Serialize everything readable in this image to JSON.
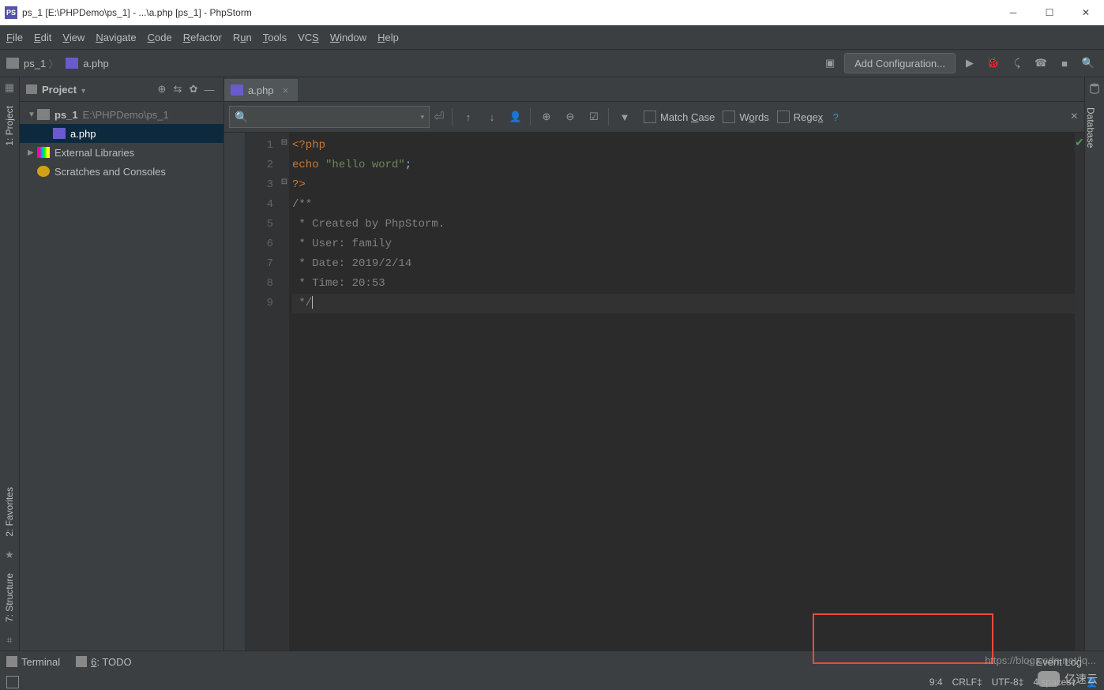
{
  "titlebar": {
    "app_badge": "PS",
    "title": "ps_1 [E:\\PHPDemo\\ps_1] - ...\\a.php [ps_1] - PhpStorm"
  },
  "menu": [
    "File",
    "Edit",
    "View",
    "Navigate",
    "Code",
    "Refactor",
    "Run",
    "Tools",
    "VCS",
    "Window",
    "Help"
  ],
  "breadcrumbs": {
    "project": "ps_1",
    "file": "a.php"
  },
  "toolbar": {
    "add_config": "Add Configuration..."
  },
  "project_panel": {
    "title": "Project",
    "root": {
      "name": "ps_1",
      "path": "E:\\PHPDemo\\ps_1"
    },
    "file": "a.php",
    "ext_lib": "External Libraries",
    "scratch": "Scratches and Consoles"
  },
  "tab": {
    "name": "a.php"
  },
  "findbar": {
    "match_case": "Match Case",
    "words": "Words",
    "regex": "Regex"
  },
  "code_lines": {
    "l1_open": "<?php",
    "l2_kw": "echo ",
    "l2_str": "\"hello word\"",
    "l2_end": ";",
    "l3_close": "?>",
    "l4": "/**",
    "l5": " * Created by PhpStorm.",
    "l6": " * User: family",
    "l7": " * Date: 2019/2/14",
    "l8": " * Time: 20:53",
    "l9": " */"
  },
  "left_tabs": {
    "project": "1: Project",
    "favorites": "2: Favorites",
    "structure": "7: Structure"
  },
  "right_tabs": {
    "database": "Database"
  },
  "bottom": {
    "terminal": "Terminal",
    "todo": "6: TODO",
    "eventlog": "Event Log"
  },
  "status": {
    "pos": "9:4",
    "sep1": "CRLF",
    "enc": "UTF-8",
    "indent": "4 spaces"
  },
  "watermark": "https://blog.csdn.net/lq...",
  "watermark2": "亿速云"
}
